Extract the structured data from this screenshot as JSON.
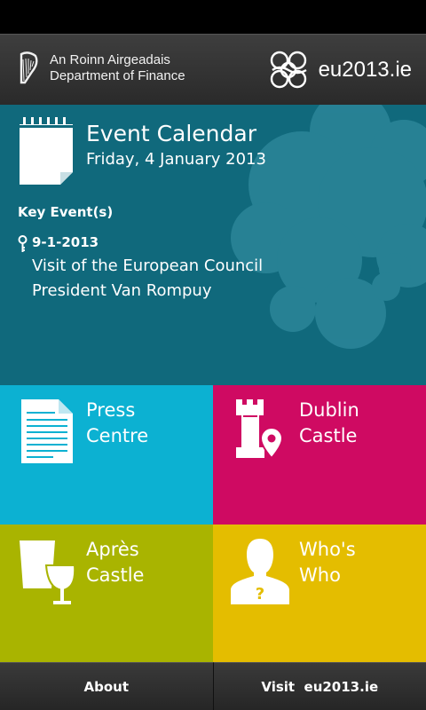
{
  "header": {
    "dept_line1": "An Roinn Airgeadais",
    "dept_line2": "Department of Finance",
    "eu_site": "eu2013.ie"
  },
  "calendar": {
    "title": "Event Calendar",
    "date": "Friday, 4 January 2013",
    "key_events_label": "Key Event(s)",
    "events": [
      {
        "date": "9-1-2013",
        "line1": "Visit of the European Council",
        "line2": "President Van Rompuy"
      }
    ]
  },
  "tiles": {
    "press": {
      "line1": "Press",
      "line2": "Centre"
    },
    "castle": {
      "line1": "Dublin",
      "line2": "Castle"
    },
    "apres": {
      "line1": "Après",
      "line2": "Castle"
    },
    "who": {
      "line1": "Who's",
      "line2": "Who"
    }
  },
  "bottom": {
    "about": "About",
    "visit": "Visit  eu2013.ie"
  },
  "colors": {
    "calendar": "#10697c",
    "press": "#0cb1d2",
    "castle": "#cf0a62",
    "apres": "#a9b400",
    "who": "#e4bd00"
  },
  "icons": [
    "harp-icon",
    "eu-presidency-logo-icon",
    "calendar-icon",
    "key-icon",
    "document-icon",
    "castle-location-icon",
    "glasses-icon",
    "person-question-icon"
  ]
}
